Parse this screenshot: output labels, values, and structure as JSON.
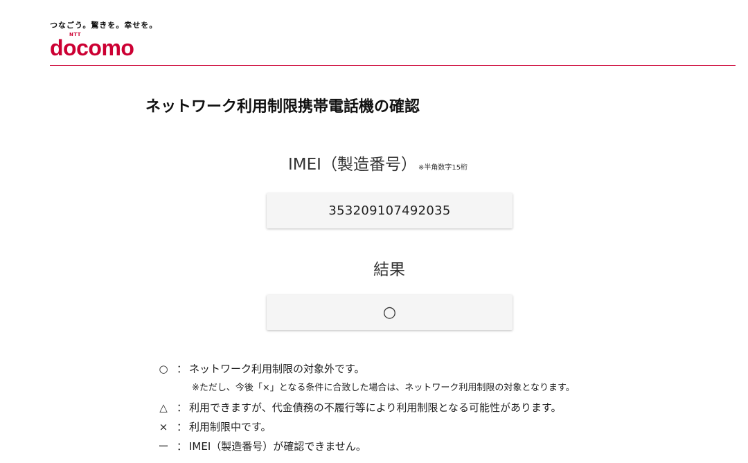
{
  "header": {
    "tagline": "つなごう。驚きを。幸せを。",
    "logo_ntt": "NTT",
    "logo_word": "docomo"
  },
  "page": {
    "title": "ネットワーク利用制限携帯電話機の確認"
  },
  "imei": {
    "label": "IMEI（製造番号）",
    "note": "※半角数字15桁",
    "value": "353209107492035"
  },
  "result": {
    "label": "結果",
    "value": "○"
  },
  "legend": {
    "colon": "：",
    "items": [
      {
        "symbol": "○",
        "text": "ネットワーク利用制限の対象外です。"
      },
      {
        "symbol": "△",
        "text": "利用できますが、代金債務の不履行等により利用制限となる可能性があります。"
      },
      {
        "symbol": "×",
        "text": "利用制限中です。"
      },
      {
        "symbol": "ー",
        "text": "IMEI（製造番号）が確認できません。"
      }
    ],
    "sub_note": "※ただし、今後「×」となる条件に合致した場合は、ネットワーク利用制限の対象となります。"
  },
  "colors": {
    "brand": "#cc0033",
    "box_bg": "#f5f5f5"
  }
}
